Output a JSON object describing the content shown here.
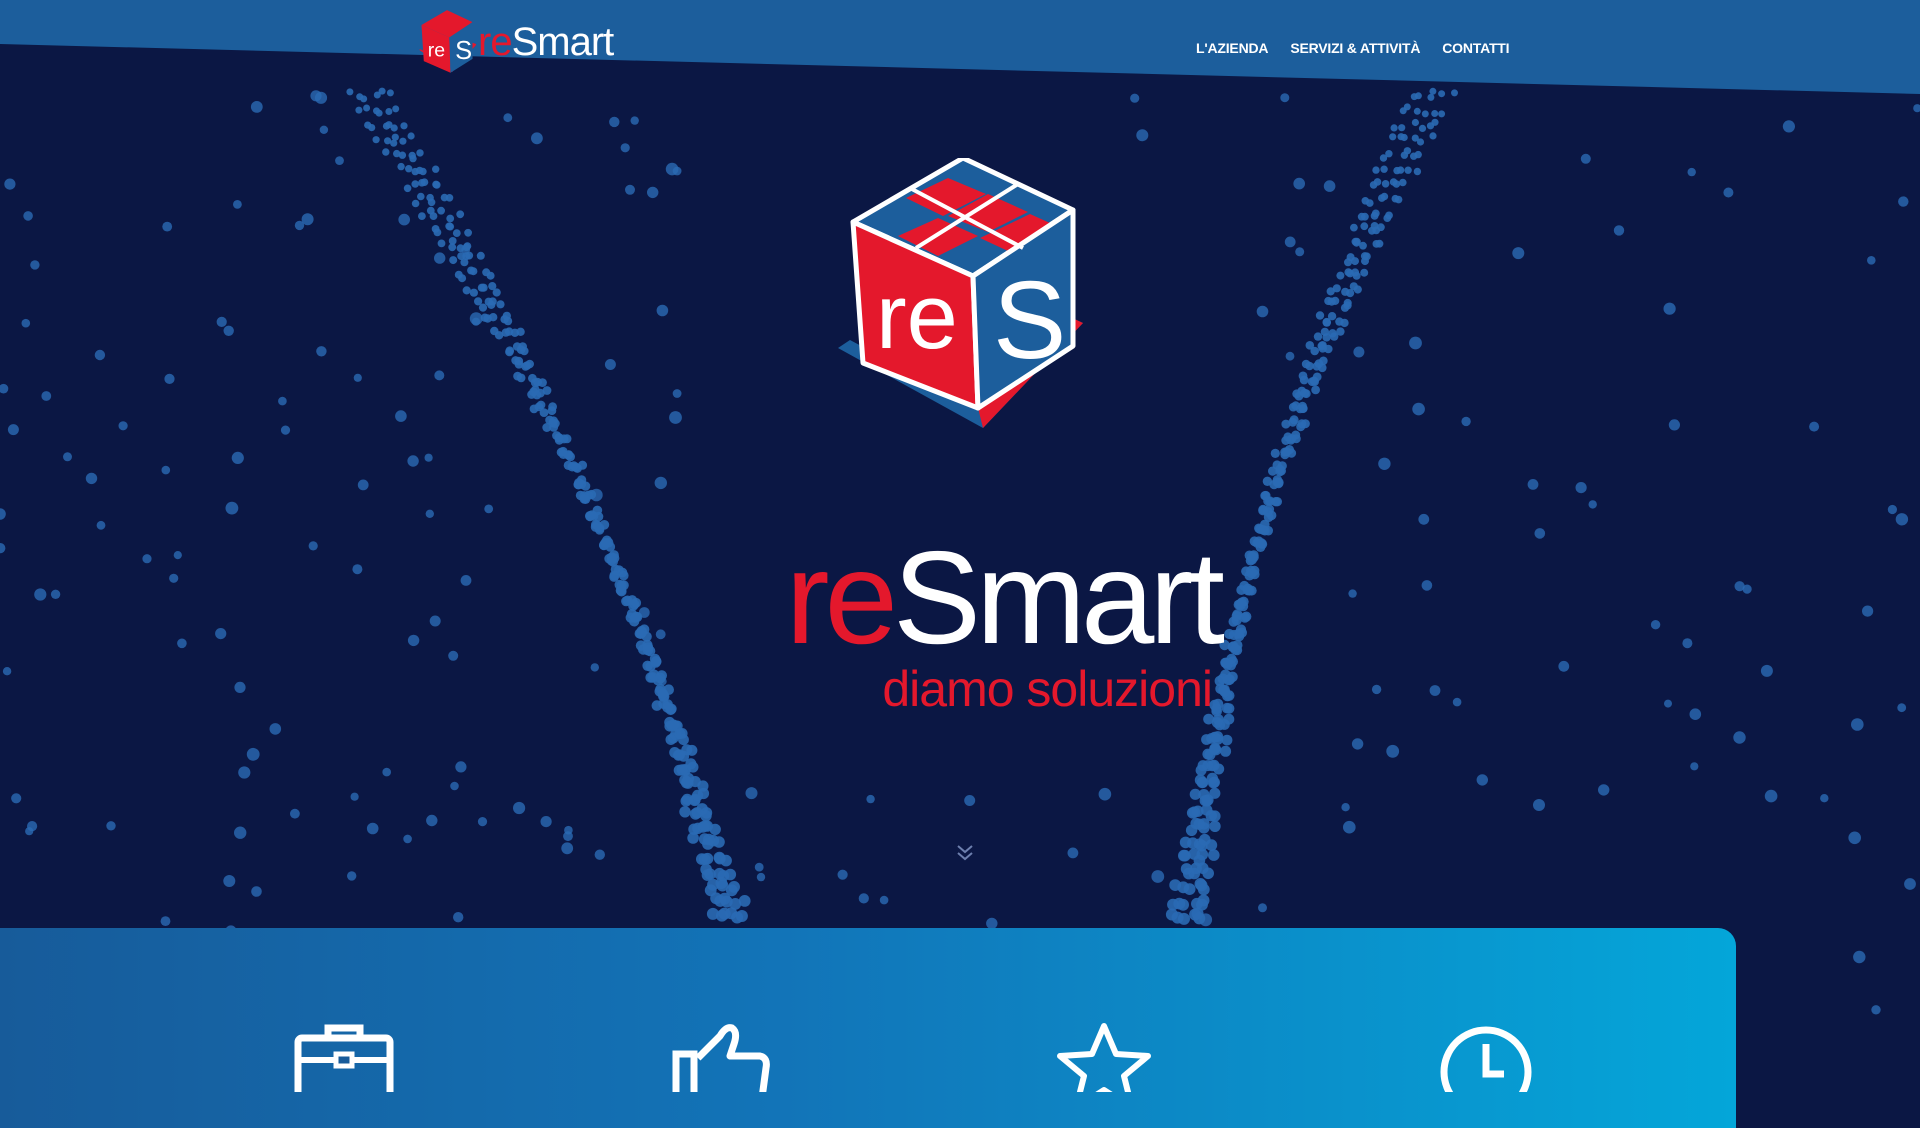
{
  "brand": {
    "logo_re": "re",
    "logo_smart": "Smart",
    "tagline": "diamo soluzioni",
    "colors": {
      "red": "#e4182c",
      "blue": "#1c5e9c",
      "navy": "#0b1744",
      "white": "#ffffff"
    }
  },
  "nav": {
    "items": [
      {
        "label": "L'AZIENDA"
      },
      {
        "label": "SERVIZI & ATTIVITÀ"
      },
      {
        "label": "CONTATTI"
      }
    ]
  },
  "hero": {
    "cube_face_left": "re",
    "cube_face_right": "S",
    "scroll_icon": "double-chevron-down-icon"
  },
  "features": {
    "icons": [
      "briefcase-icon",
      "thumbs-up-icon",
      "star-icon",
      "clock-icon"
    ]
  }
}
